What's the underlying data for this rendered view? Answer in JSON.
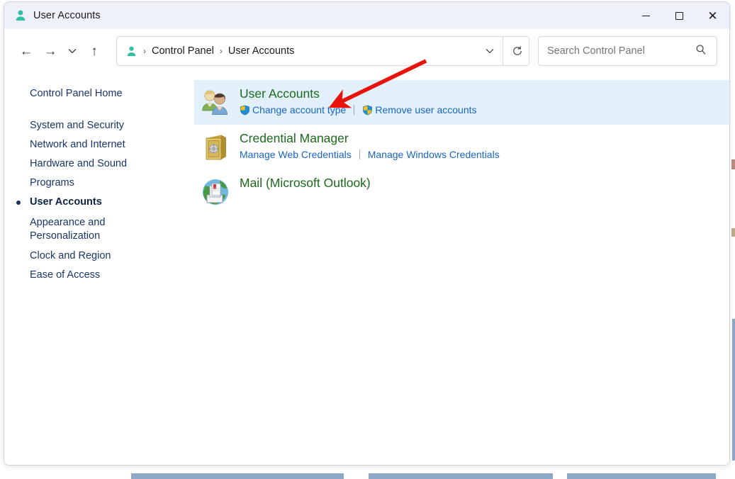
{
  "window": {
    "title": "User Accounts",
    "title_icon": "user-account-icon",
    "controls": {
      "minimize": "–",
      "maximize": "☐",
      "close": "×"
    }
  },
  "toolbar": {
    "back_icon": "back-arrow-icon",
    "forward_icon": "forward-arrow-icon",
    "recent_icon": "chevron-down-icon",
    "up_icon": "up-arrow-icon",
    "address_icon": "user-account-icon",
    "breadcrumbs": [
      {
        "label": "Control Panel"
      },
      {
        "label": "User Accounts"
      }
    ],
    "breadcrumb_separator": "›",
    "address_dropdown_icon": "chevron-down-icon",
    "refresh_icon": "refresh-icon"
  },
  "search": {
    "placeholder": "Search Control Panel",
    "value": "",
    "icon": "search-icon"
  },
  "sidebar": {
    "items": [
      {
        "label": "Control Panel Home",
        "current": false
      },
      {
        "label": "System and Security",
        "current": false
      },
      {
        "label": "Network and Internet",
        "current": false
      },
      {
        "label": "Hardware and Sound",
        "current": false
      },
      {
        "label": "Programs",
        "current": false
      },
      {
        "label": "User Accounts",
        "current": true
      },
      {
        "label": "Appearance and Personalization",
        "current": false
      },
      {
        "label": "Clock and Region",
        "current": false
      },
      {
        "label": "Ease of Access",
        "current": false
      }
    ]
  },
  "content": {
    "categories": [
      {
        "title": "User Accounts",
        "icon": "two-users-icon",
        "highlighted": true,
        "links": [
          {
            "label": "Change account type",
            "shield": true
          },
          {
            "label": "Remove user accounts",
            "shield": true
          }
        ]
      },
      {
        "title": "Credential Manager",
        "icon": "vault-icon",
        "highlighted": false,
        "links": [
          {
            "label": "Manage Web Credentials",
            "shield": false
          },
          {
            "label": "Manage Windows Credentials",
            "shield": false
          }
        ]
      },
      {
        "title": "Mail (Microsoft Outlook)",
        "icon": "mail-globe-icon",
        "highlighted": false,
        "links": []
      }
    ]
  },
  "annotation": {
    "arrow_color": "#e8140c",
    "arrow_name": "red-pointer-arrow"
  },
  "colors": {
    "titlebar_bg": "#eef1fa",
    "highlight_bg": "#e2f0fb",
    "category_title": "#1b6a1b",
    "link_blue": "#1866c0",
    "sidebar_text": "#1a3668",
    "accent_teal": "#2fbfa5"
  }
}
